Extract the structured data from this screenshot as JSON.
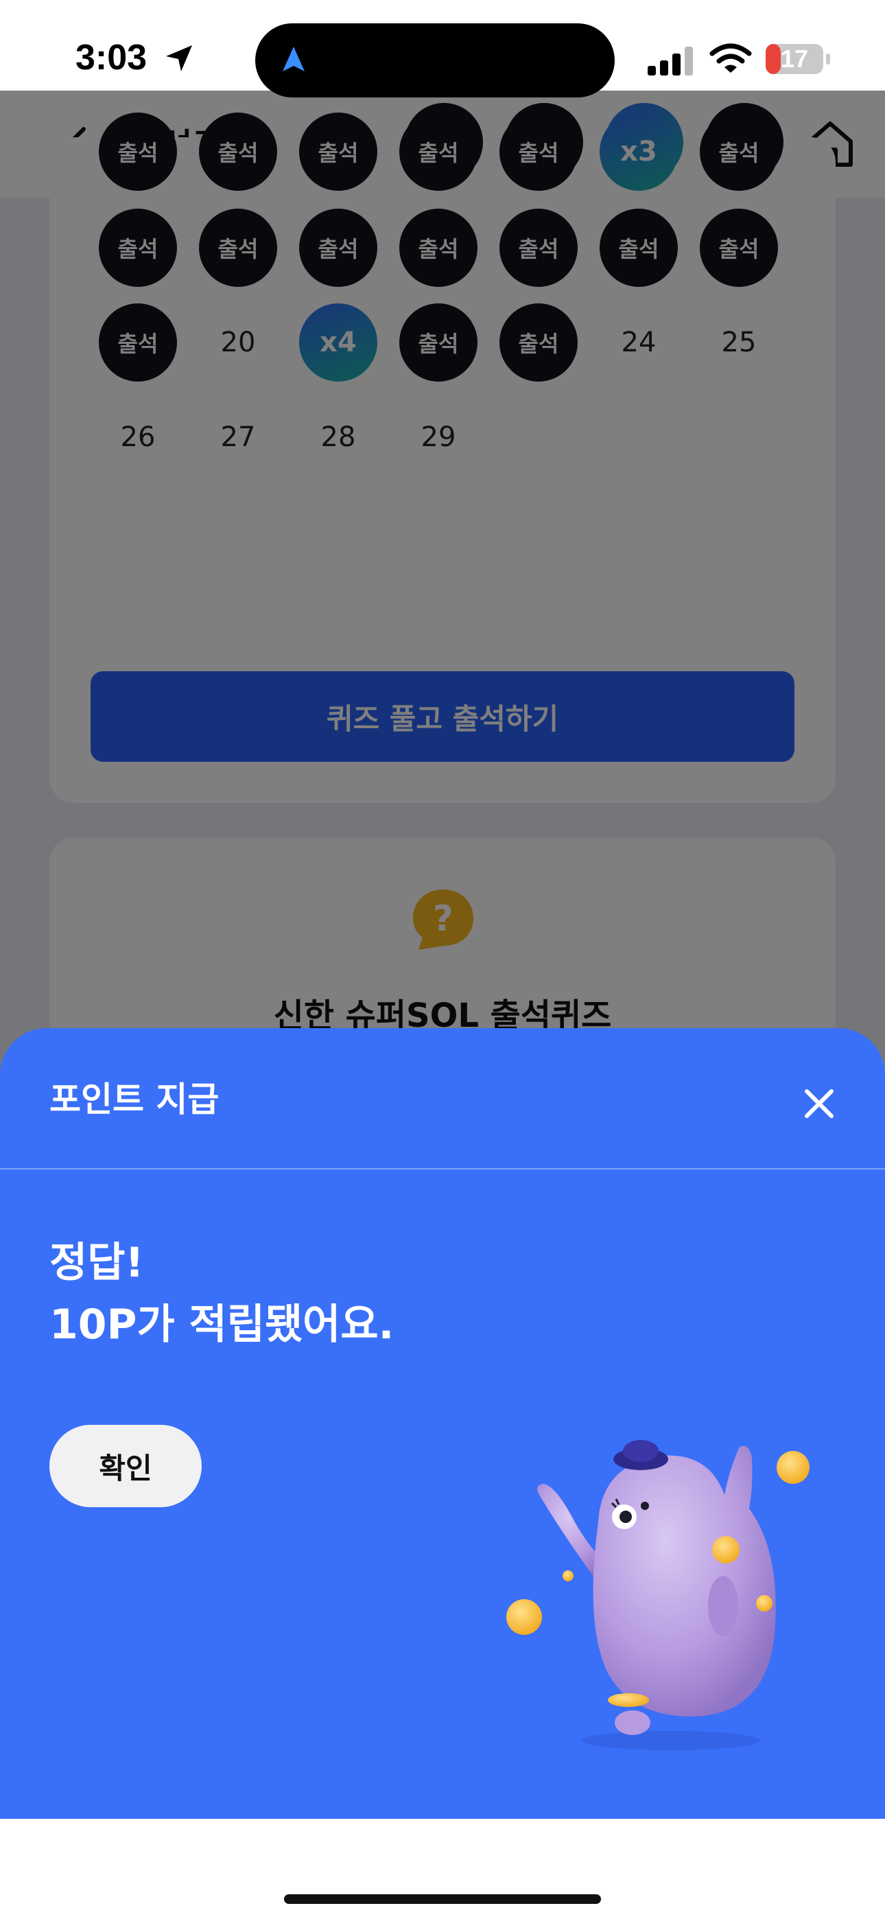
{
  "status_bar": {
    "time": "3:03",
    "battery": "17",
    "icons": [
      "location-arrow-icon",
      "navigation-icon",
      "cellular-signal-icon",
      "wifi-icon",
      "battery-icon"
    ]
  },
  "header": {
    "title": "출석퀴즈",
    "back_icon": "chevron-left-icon",
    "home_icon": "home-icon"
  },
  "calendar": {
    "rows": [
      [
        {
          "label": "출석",
          "kind": "att"
        },
        {
          "label": "출석",
          "kind": "att"
        },
        {
          "label": "출석",
          "kind": "att"
        },
        {
          "label": "출석",
          "kind": "att"
        },
        {
          "label": "출석",
          "kind": "att"
        },
        {
          "label": "x3",
          "kind": "mult"
        },
        {
          "label": "출석",
          "kind": "att"
        }
      ],
      [
        {
          "label": "출석",
          "kind": "att"
        },
        {
          "label": "출석",
          "kind": "att"
        },
        {
          "label": "출석",
          "kind": "att"
        },
        {
          "label": "출석",
          "kind": "att"
        },
        {
          "label": "출석",
          "kind": "att"
        },
        {
          "label": "출석",
          "kind": "att"
        },
        {
          "label": "출석",
          "kind": "att"
        }
      ],
      [
        {
          "label": "출석",
          "kind": "att"
        },
        {
          "label": "20",
          "kind": "date"
        },
        {
          "label": "x4",
          "kind": "mult"
        },
        {
          "label": "출석",
          "kind": "att"
        },
        {
          "label": "출석",
          "kind": "att"
        },
        {
          "label": "24",
          "kind": "date"
        },
        {
          "label": "25",
          "kind": "date"
        }
      ],
      [
        {
          "label": "26",
          "kind": "date"
        },
        {
          "label": "27",
          "kind": "date"
        },
        {
          "label": "28",
          "kind": "date"
        },
        {
          "label": "29",
          "kind": "date"
        }
      ]
    ],
    "button_label": "퀴즈 풀고 출석하기"
  },
  "quiz_card": {
    "title": "신한 슈퍼SOL 출석퀴즈",
    "icon": "question-bubble-icon"
  },
  "sheet": {
    "title": "포인트 지급",
    "message_line1": "정답!",
    "message_line2": "10P가 적립됐어요.",
    "confirm_label": "확인",
    "close_icon": "close-icon",
    "illustration": "mascot-with-coins"
  },
  "colors": {
    "accent": "#3a6ff8",
    "button": "#2b62f6",
    "attended": "#111318"
  }
}
